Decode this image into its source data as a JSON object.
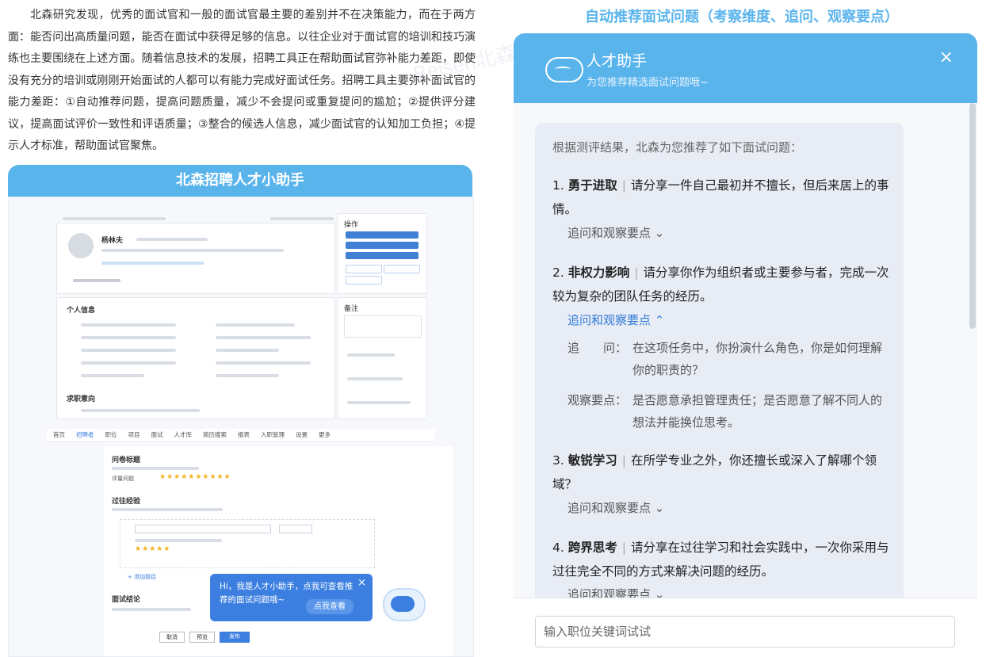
{
  "article": {
    "paragraph": "北森研究发现，优秀的面试官和一般的面试官最主要的差别并不在决策能力，而在于两方面：能否问出高质量问题，能否在面试中获得足够的信息。以往企业对于面试官的培训和技巧演练也主要围绕在上述方面。随着信息技术的发展，招聘工具正在帮助面试官弥补能力差距，即使没有充分的培训或刚刚开始面试的人都可以有能力完成好面试任务。招聘工具主要弥补面试官的能力差距：①自动推荐问题，提高问题质量，减少不会提问或重复提问的尴尬；②提供评分建议，提高面试评价一致性和评语质量；③整合的候选人信息，减少面试官的认知加工负担；④提示人才标准，帮助面试官聚焦。"
  },
  "left_banner": {
    "title": "北森招聘人才小助手"
  },
  "left_screenshot": {
    "candidate_name": "杨林夫",
    "section_personal": "个人信息",
    "section_intention": "求职意向",
    "section_ops": "操作",
    "section_notes": "备注",
    "nav_items": [
      "首页",
      "招聘者",
      "职位",
      "项目",
      "面试",
      "人才库",
      "简历搜索",
      "报表",
      "入职管理",
      "设置",
      "更多"
    ],
    "form_title": "问卷标题",
    "form_section_1": "过往经验",
    "form_section_2": "面试结论",
    "rating_label": "评量问题",
    "stars": "★★★★★★★★★★",
    "stars_small": "★★★★★",
    "add_question": "+ 添加题目",
    "footer_buttons": [
      "取消",
      "预览",
      "发布"
    ],
    "assistant_bubble": {
      "text": "Hi，我是人才小助手，点我可查看推荐的面试问题哦~",
      "button": "点我查看",
      "close": "×"
    }
  },
  "right_heading": "自动推荐面试问题（考察维度、追问、观察要点）",
  "chat": {
    "title": "人才助手",
    "subtitle": "为您推荐精选面试问题哦~",
    "close": "×",
    "intro": "根据测评结果，北森为您推荐了如下面试问题：",
    "questions": [
      {
        "num": "1.",
        "dimension": "勇于进取",
        "text": "请分享一件自己最初并不擅长，但后来居上的事情。",
        "toggle": "追问和观察要点 ⌄"
      },
      {
        "num": "2.",
        "dimension": "非权力影响",
        "text": "请分享你作为组织者或主要参与者，完成一次较为复杂的团队任务的经历。",
        "toggle": "追问和观察要点 ⌃",
        "followup_label": "追　　问：",
        "followup": "在这项任务中，你扮演什么角色，你是如何理解你的职责的？",
        "observe_label": "观察要点：",
        "observe": "是否愿意承担管理责任；是否愿意了解不同人的想法并能换位思考。"
      },
      {
        "num": "3.",
        "dimension": "敏锐学习",
        "text": "在所学专业之外，你还擅长或深入了解哪个领域？",
        "toggle": "追问和观察要点 ⌄"
      },
      {
        "num": "4.",
        "dimension": "跨界思考",
        "text": "请分享在过往学习和社会实践中，一次你采用与过往完全不同的方式来解决问题的经历。",
        "toggle": "追问和观察要点 ⌄"
      }
    ],
    "input_placeholder": "输入职位关键词试试"
  },
  "watermark": "Beisen北森",
  "colors": {
    "accent": "#5ab4ec",
    "brand_blue": "#3c7fe0",
    "link": "#2d7ad6"
  }
}
